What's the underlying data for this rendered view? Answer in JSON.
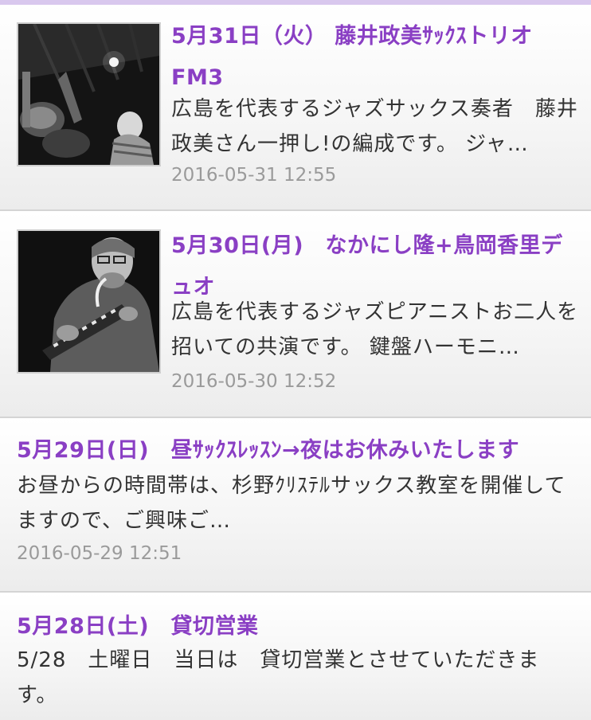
{
  "colors": {
    "title": "#8a3fc4",
    "excerpt": "#333333",
    "date": "#9a9a9a",
    "top_accent": "#d9c8ee",
    "divider": "#d4d4d4"
  },
  "posts": [
    {
      "title": "5月31日（火） 藤井政美ｻｯｸｽトリオ　FM3",
      "excerpt": "広島を代表するジャズサックス奏者　藤井政美さん一押し!の編成です。 ジャ…",
      "date": "2016-05-31 12:55",
      "thumbnail": "band-photo"
    },
    {
      "title": "5月30日(月)　なかにし隆+鳥岡香里デュオ",
      "excerpt": "広島を代表するジャズピアニストお二人を招いての共演です。 鍵盤ハーモニ…",
      "date": "2016-05-30 12:52",
      "thumbnail": "melodica-player-photo"
    },
    {
      "title": "5月29日(日)　昼ｻｯｸｽﾚｯｽﾝ→夜はお休みいたします",
      "excerpt": "お昼からの時間帯は、杉野ｸﾘｽﾃﾙサックス教室を開催してますので、ご興味ご…",
      "date": "2016-05-29 12:51"
    },
    {
      "title": "5月28日(土)　貸切営業",
      "excerpt": "5/28　土曜日　当日は　貸切営業とさせていただきます。"
    }
  ]
}
